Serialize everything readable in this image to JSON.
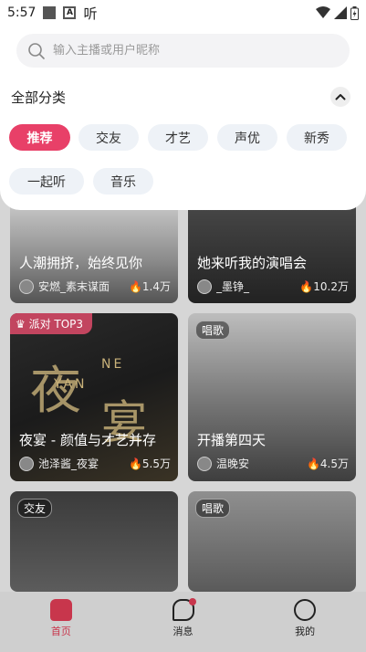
{
  "status_bar": {
    "time": "5:57",
    "listen_glyph": "听"
  },
  "search": {
    "placeholder": "输入主播或用户昵称"
  },
  "categories": {
    "header": "全部分类",
    "chips": [
      "推荐",
      "交友",
      "才艺",
      "声优",
      "新秀",
      "一起听",
      "音乐"
    ],
    "active": "推荐"
  },
  "cards": [
    {
      "title": "人潮拥挤，始终见你",
      "host": "安燃_素末谋面",
      "heat": "1.4万"
    },
    {
      "title": "她来听我的演唱会",
      "host": "_墨铮_",
      "heat": "10.2万"
    },
    {
      "top_tag": "派对 TOP3",
      "title": "夜宴 - 颜值与才艺并存",
      "host": "池泽酱_夜宴",
      "heat": "5.5万",
      "art": {
        "yan1": "夜",
        "yan2": "宴",
        "ne": "NE",
        "yan_en": "YAN"
      }
    },
    {
      "tag": "唱歌",
      "title": "开播第四天",
      "host": "温晚安",
      "heat": "4.5万"
    },
    {
      "tag": "交友"
    },
    {
      "tag": "唱歌"
    }
  ],
  "bottom_nav": [
    {
      "label": "首页",
      "icon": "home-icon",
      "active": true
    },
    {
      "label": "消息",
      "icon": "message-icon",
      "badge": true
    },
    {
      "label": "我的",
      "icon": "smile-face-icon"
    }
  ],
  "colors": {
    "accent": "#e84068",
    "chip_bg": "#eef2f7",
    "nav_active": "#c8364c"
  }
}
